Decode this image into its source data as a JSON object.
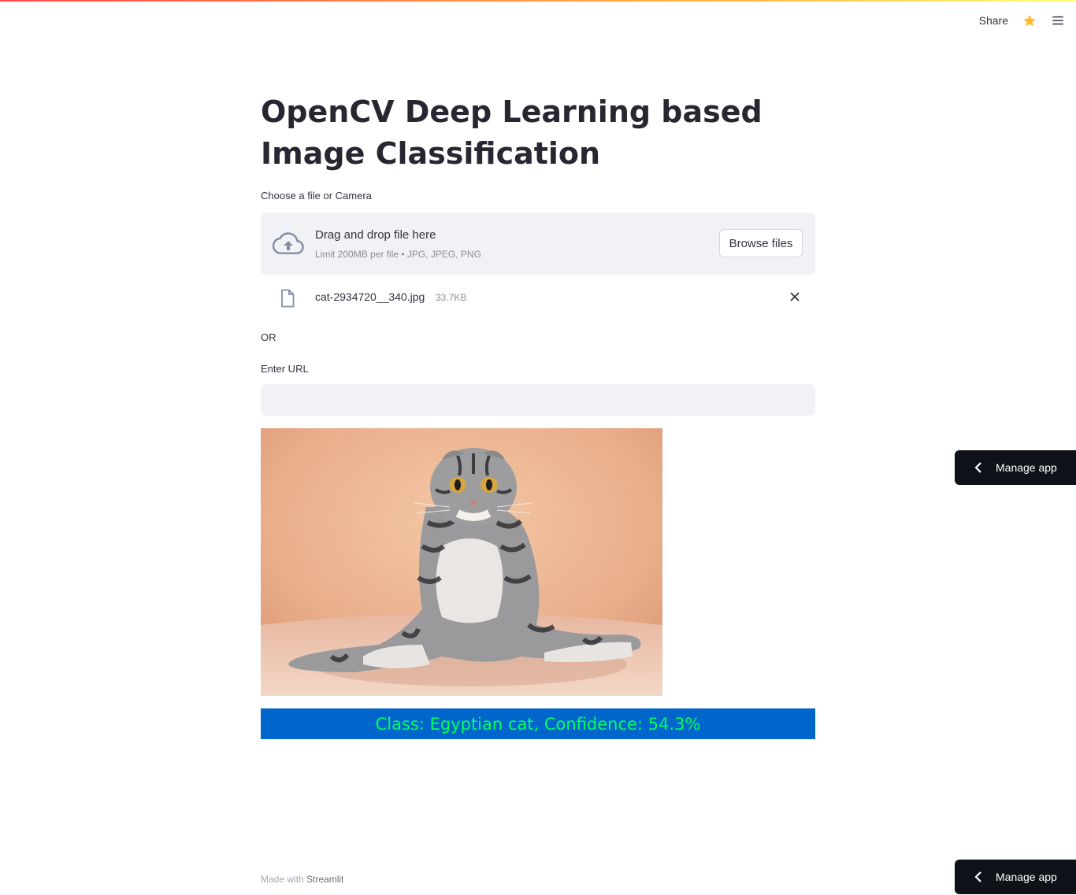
{
  "header": {
    "share_label": "Share",
    "star_icon": "star-icon",
    "menu_icon": "hamburger-menu-icon",
    "accent_color": "#ffbd45"
  },
  "main": {
    "title": "OpenCV Deep Learning based Image Classification",
    "uploader": {
      "label": "Choose a file or Camera",
      "drop_title": "Drag and drop file here",
      "drop_limit": "Limit 200MB per file • JPG, JPEG, PNG",
      "browse_label": "Browse files",
      "icon": "cloud-upload-icon"
    },
    "uploaded_file": {
      "name": "cat-2934720__340.jpg",
      "size": "33.7KB",
      "icon": "file-icon",
      "remove_icon": "close-icon"
    },
    "or_text": "OR",
    "url": {
      "label": "Enter URL",
      "value": ""
    },
    "image": {
      "alt": "cat-2934720__340.jpg"
    },
    "result": {
      "text": "Class: Egyptian cat, Confidence: 54.3%",
      "bg_color": "#0066cc",
      "text_color": "#00ff5a"
    }
  },
  "footer": {
    "prefix": "Made with",
    "brand": "Streamlit"
  },
  "manage_app": {
    "label": "Manage app",
    "icon": "chevron-left-icon"
  }
}
